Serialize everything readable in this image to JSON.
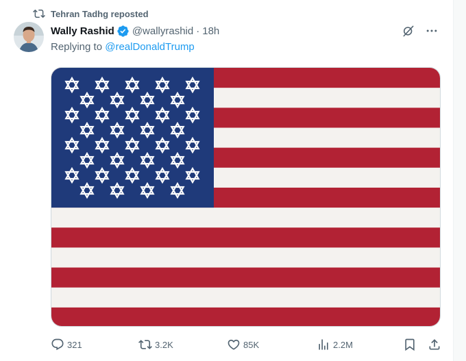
{
  "repost": {
    "label": "Tehran Tadhg reposted",
    "icon": "repost-icon"
  },
  "post": {
    "author_name": "Wally Rashid",
    "verified_icon": "verified-badge-icon",
    "handle": "@wallyrashid",
    "separator": "·",
    "time": "18h",
    "replying_prefix": "Replying to",
    "replying_to": "@realDonaldTrump",
    "image_icon": "us-flag-with-star-of-david-image"
  },
  "top_actions": {
    "grok_icon": "grok-icon",
    "more_icon": "more-icon"
  },
  "engagement": {
    "replies": "321",
    "reposts": "3.2K",
    "likes": "85K",
    "views": "2.2M"
  },
  "colors": {
    "accent": "#1d9bf0",
    "muted": "#536471",
    "flag_red": "#b22234",
    "flag_blue": "#1f3a7a"
  }
}
